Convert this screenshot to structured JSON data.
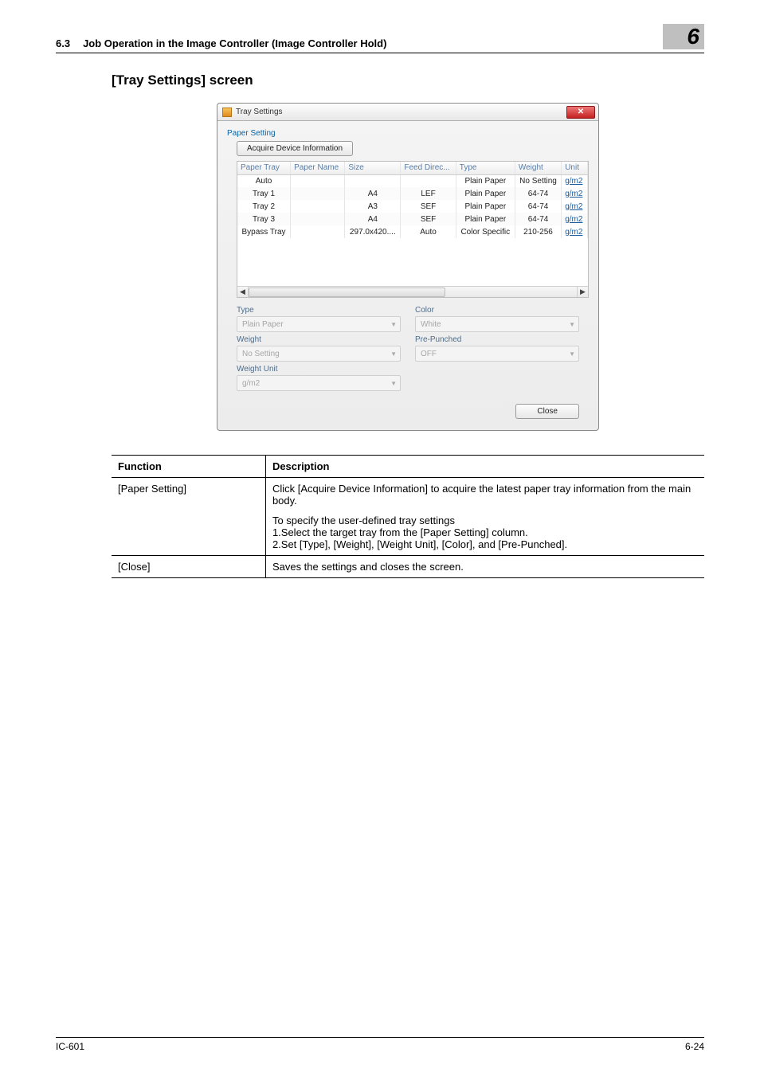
{
  "header": {
    "section_num": "6.3",
    "section_title": "Job Operation in the Image Controller (Image Controller Hold)",
    "chapter": "6"
  },
  "subheading": "[Tray Settings] screen",
  "dialog": {
    "title": "Tray Settings",
    "group_title": "Paper Setting",
    "acquire_btn": "Acquire Device Information",
    "columns": [
      "Paper Tray",
      "Paper Name",
      "Size",
      "Feed Direc...",
      "Type",
      "Weight",
      "Unit"
    ],
    "rows": [
      {
        "tray": "Auto",
        "name": "",
        "size": "",
        "feed": "",
        "type": "Plain Paper",
        "weight": "No Setting",
        "unit": "g/m2"
      },
      {
        "tray": "Tray 1",
        "name": "",
        "size": "A4",
        "feed": "LEF",
        "type": "Plain Paper",
        "weight": "64-74",
        "unit": "g/m2"
      },
      {
        "tray": "Tray 2",
        "name": "",
        "size": "A3",
        "feed": "SEF",
        "type": "Plain Paper",
        "weight": "64-74",
        "unit": "g/m2"
      },
      {
        "tray": "Tray 3",
        "name": "",
        "size": "A4",
        "feed": "SEF",
        "type": "Plain Paper",
        "weight": "64-74",
        "unit": "g/m2"
      },
      {
        "tray": "Bypass Tray",
        "name": "",
        "size": "297.0x420....",
        "feed": "Auto",
        "type": "Color Specific",
        "weight": "210-256",
        "unit": "g/m2"
      }
    ],
    "fields": {
      "type_label": "Type",
      "type_value": "Plain Paper",
      "color_label": "Color",
      "color_value": "White",
      "weight_label": "Weight",
      "weight_value": "No Setting",
      "prepunched_label": "Pre-Punched",
      "prepunched_value": "OFF",
      "weightunit_label": "Weight Unit",
      "weightunit_value": "g/m2"
    },
    "close_btn": "Close",
    "scroll_left": "◀",
    "scroll_right": "▶",
    "close_x": "✕"
  },
  "desc_headers": {
    "function": "Function",
    "description": "Description"
  },
  "desc_rows": [
    {
      "func": "[Paper Setting]",
      "desc1": "Click [Acquire Device Information] to acquire the latest paper tray information from the main body.",
      "desc2": "To specify the user-defined tray settings",
      "desc3": "1.Select the target tray from the [Paper Setting] column.",
      "desc4": "2.Set [Type], [Weight], [Weight Unit], [Color], and [Pre-Punched]."
    },
    {
      "func": "[Close]",
      "desc1": "Saves the settings and closes the screen."
    }
  ],
  "footer": {
    "left": "IC-601",
    "right": "6-24"
  }
}
